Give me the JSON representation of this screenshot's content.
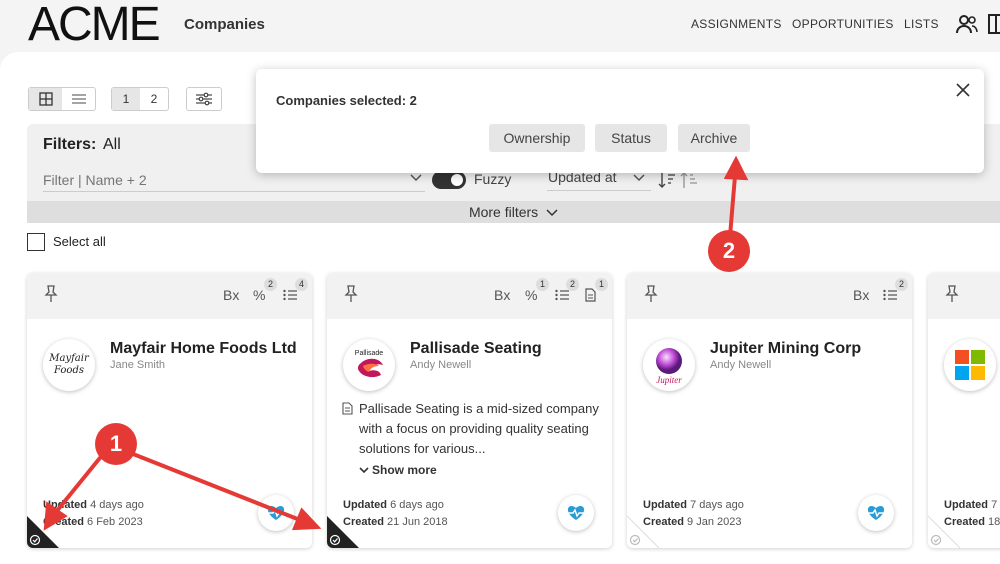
{
  "header": {
    "logo": "ACME",
    "page_title": "Companies",
    "nav": [
      "ASSIGNMENTS",
      "OPPORTUNITIES",
      "LISTS"
    ]
  },
  "toolbar": {
    "pages": [
      "1",
      "2"
    ]
  },
  "filters": {
    "label": "Filters:",
    "value": "All",
    "placeholder": "Filter | Name + 2",
    "fuzzy_label": "Fuzzy",
    "sort_label": "Updated at",
    "more_filters": "More filters"
  },
  "select_all": "Select all",
  "popup": {
    "title": "Companies selected: 2",
    "buttons": [
      "Ownership",
      "Status",
      "Archive"
    ]
  },
  "cards": [
    {
      "badges": {
        "percent": "2",
        "list": "4"
      },
      "head_bx": "Bx",
      "logo_text": "Mayfair Foods",
      "title": "Mayfair Home Foods Ltd",
      "owner": "Jane Smith",
      "updated_label": "Updated",
      "updated": "4 days ago",
      "created_label": "Created",
      "created": "6 Feb 2023",
      "selected": true
    },
    {
      "badges": {
        "percent": "1",
        "list": "2",
        "doc": "1"
      },
      "head_bx": "Bx",
      "logo_text": "Pallisade",
      "title": "Pallisade Seating",
      "owner": "Andy Newell",
      "description": "Pallisade Seating is a mid-sized company with a focus on providing quality seating solutions for various...",
      "show_more": "Show more",
      "updated_label": "Updated",
      "updated": "6 days ago",
      "created_label": "Created",
      "created": "21 Jun 2018",
      "selected": true
    },
    {
      "badges": {
        "list": "2"
      },
      "head_bx": "Bx",
      "logo_text": "Jupiter",
      "title": "Jupiter Mining Corp",
      "owner": "Andy Newell",
      "updated_label": "Updated",
      "updated": "7 days ago",
      "created_label": "Created",
      "created": "9 Jan 2023",
      "selected": false
    },
    {
      "updated_label": "Updated",
      "updated": "7",
      "created_label": "Created",
      "created": "18",
      "selected": false
    }
  ],
  "annotations": {
    "one": "1",
    "two": "2"
  },
  "colors": {
    "annotation": "#e53935",
    "health": "#2b9bd6",
    "selected_corner": "#222222"
  }
}
